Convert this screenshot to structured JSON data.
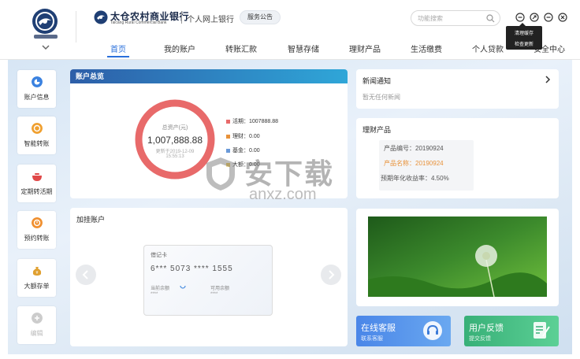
{
  "header": {
    "bank_name": "太仓农村商业银行",
    "bank_name_en": "Taicang Rural Commercial Bank",
    "netbank": "个人网上银行",
    "notice_button": "服务公告",
    "search_placeholder": "功能搜索",
    "tooltip": {
      "line1": "清理缓存",
      "line2": "检查更新"
    }
  },
  "nav": {
    "items": [
      "首页",
      "我的账户",
      "转账汇款",
      "智慧存储",
      "理财产品",
      "生活缴费",
      "个人贷款",
      "安全中心"
    ],
    "active_index": 0
  },
  "sidebar": {
    "items": [
      {
        "label": "账户信息",
        "icon": "pie-chart-icon",
        "color": "#3b82e0"
      },
      {
        "label": "智能转账",
        "icon": "transfer-icon",
        "color": "#f0a030"
      },
      {
        "label": "定期转活期",
        "icon": "pot-icon",
        "color": "#e04848"
      },
      {
        "label": "预约转账",
        "icon": "clock-icon",
        "color": "#f09030"
      },
      {
        "label": "大额存单",
        "icon": "money-bag-icon",
        "color": "#e0a030"
      },
      {
        "label": "编辑",
        "icon": "add-icon",
        "color": "#cccccc"
      }
    ]
  },
  "overview": {
    "title": "账户总览",
    "total_label": "总资产(元)",
    "total_value": "1,007,888.88",
    "updated_label": "更新于2019-12-09",
    "updated_time": "15:55:13",
    "legend": [
      {
        "label": "活期：1007888.88",
        "color": "#e86a6a"
      },
      {
        "label": "理财：0.00",
        "color": "#e8923a"
      },
      {
        "label": "基金：0.00",
        "color": "#6a9ad8"
      },
      {
        "label": "大额：0.00",
        "color": "#e8c040"
      }
    ]
  },
  "linked_accounts": {
    "title": "加挂账户",
    "card": {
      "type": "借记卡",
      "number": "6*** 5073 **** 1555",
      "balance_label": "当前余额",
      "available_label": "可用余额",
      "balance_value": "****",
      "available_value": "****"
    }
  },
  "news": {
    "title": "新闻通知",
    "empty_text": "暂无任何新闻"
  },
  "wealth": {
    "title": "理财产品",
    "product_code": "产品编号：20190924",
    "product_name": "产品名称：20190924",
    "yield": "预期年化收益率：4.50%"
  },
  "promos": {
    "service": {
      "title": "在线客服",
      "subtitle": "联系客服"
    },
    "feedback": {
      "title": "用户反馈",
      "subtitle": "提交反馈"
    }
  },
  "watermark": {
    "text": "安下载",
    "domain": "anxz.com"
  }
}
